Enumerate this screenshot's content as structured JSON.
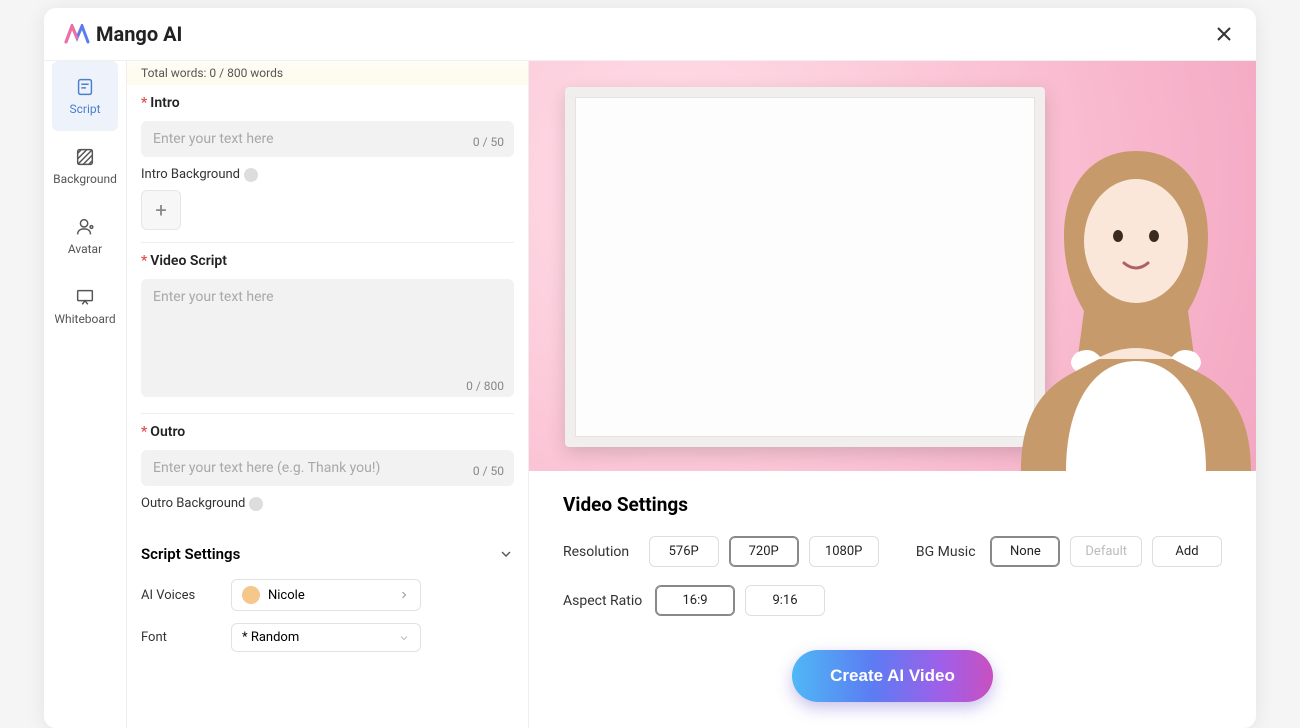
{
  "logo_text": "Mango AI",
  "sidebar": {
    "items": [
      {
        "label": "Script"
      },
      {
        "label": "Background"
      },
      {
        "label": "Avatar"
      },
      {
        "label": "Whiteboard"
      }
    ]
  },
  "wordcount": "Total words: 0 / 800 words",
  "intro": {
    "label": "Intro",
    "placeholder": "Enter your text here",
    "counter": "0 / 50",
    "bg_label": "Intro Background"
  },
  "script": {
    "label": "Video Script",
    "placeholder": "Enter your text here",
    "counter": "0 / 800"
  },
  "outro": {
    "label": "Outro",
    "placeholder": "Enter your text here (e.g. Thank you!)",
    "counter": "0 / 50",
    "bg_label": "Outro Background"
  },
  "script_settings": {
    "heading": "Script Settings",
    "voices_label": "AI Voices",
    "voice_value": "Nicole",
    "font_label": "Font",
    "font_value": "* Random"
  },
  "video_settings": {
    "title": "Video Settings",
    "resolution_label": "Resolution",
    "res_576": "576P",
    "res_720": "720P",
    "res_1080": "1080P",
    "bgmusic_label": "BG Music",
    "bg_none": "None",
    "bg_default": "Default",
    "bg_add": "Add",
    "aspect_label": "Aspect Ratio",
    "ar_169": "16:9",
    "ar_916": "9:16"
  },
  "cta": "Create AI Video"
}
